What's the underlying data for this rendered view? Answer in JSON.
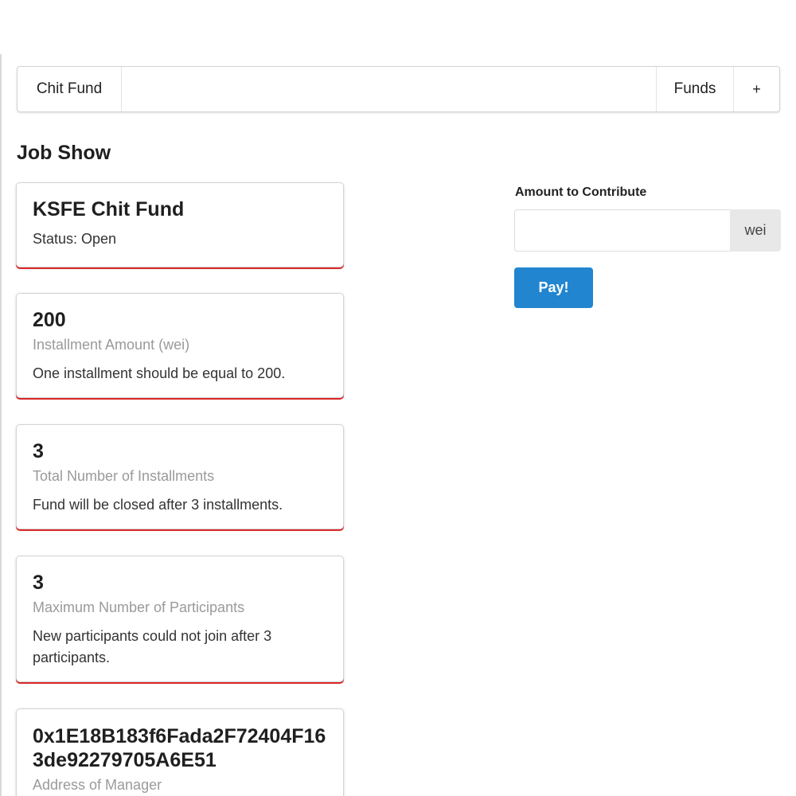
{
  "menu": {
    "brand": "Chit Fund",
    "funds": "Funds",
    "add": "+"
  },
  "page": {
    "title": "Job Show"
  },
  "fund": {
    "name": "KSFE Chit Fund",
    "status": "Status: Open"
  },
  "cards": [
    {
      "header": "200",
      "meta": "Installment Amount (wei)",
      "description": "One installment should be equal to 200."
    },
    {
      "header": "3",
      "meta": "Total Number of Installments",
      "description": "Fund will be closed after 3 installments."
    },
    {
      "header": "3",
      "meta": "Maximum Number of Participants",
      "description": "New participants could not join after 3 participants."
    },
    {
      "header": "0x1E18B183f6Fada2F72404F163de92279705A6E51",
      "meta": "Address of Manager",
      "description": ""
    }
  ],
  "contribute": {
    "label": "Amount to Contribute",
    "value": "",
    "placeholder": "",
    "unit": "wei",
    "button": "Pay!"
  },
  "colors": {
    "accent_blue": "#2185d0",
    "card_accent_red": "#db2828"
  }
}
